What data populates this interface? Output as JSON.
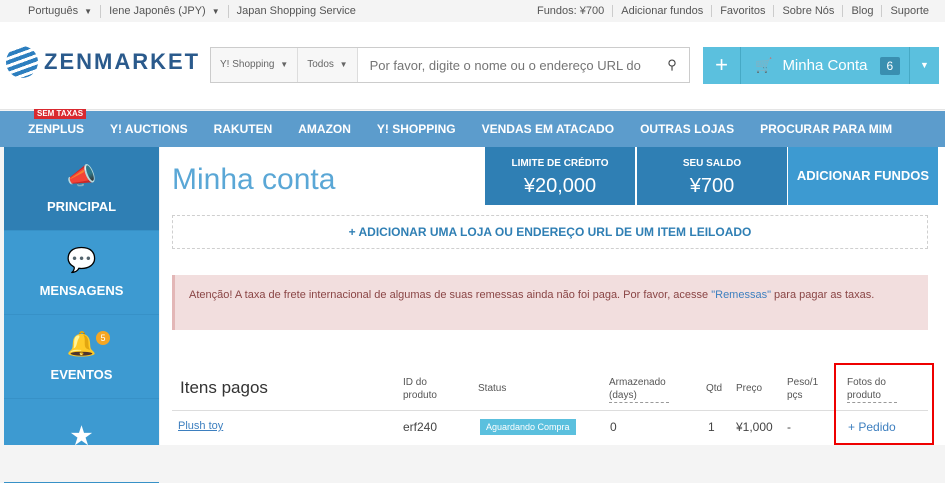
{
  "topbar": {
    "language": "Português",
    "currency": "Iene Japonês (JPY)",
    "service": "Japan Shopping Service",
    "links": [
      "Fundos: ¥700",
      "Adicionar fundos",
      "Favoritos",
      "Sobre Nós",
      "Blog",
      "Suporte"
    ]
  },
  "header": {
    "logo": "ZENMARKET",
    "search_source": "Y! Shopping",
    "search_category": "Todos",
    "search_placeholder": "Por favor, digite o nome ou o endereço URL do",
    "account_label": "Minha Conta",
    "account_badge": "6"
  },
  "nav": {
    "tag": "SEM TAXAS",
    "items": [
      "ZENPLUS",
      "Y! AUCTIONS",
      "RAKUTEN",
      "AMAZON",
      "Y! SHOPPING",
      "VENDAS EM ATACADO",
      "OUTRAS LOJAS",
      "PROCURAR PARA MIM"
    ]
  },
  "sidebar": {
    "items": [
      {
        "label": "PRINCIPAL",
        "icon": "megaphone-icon"
      },
      {
        "label": "MENSAGENS",
        "icon": "chat-icon"
      },
      {
        "label": "EVENTOS",
        "icon": "bell-icon",
        "badge": "5"
      },
      {
        "label": "",
        "icon": "star-icon"
      }
    ]
  },
  "main": {
    "title": "Minha conta",
    "credit_label": "LIMITE DE CRÉDITO",
    "credit_value": "¥20,000",
    "balance_label": "SEU SALDO",
    "balance_value": "¥700",
    "add_funds": "ADICIONAR FUNDOS",
    "add_item": "+ ADICIONAR UMA LOJA OU ENDEREÇO URL DE UM ITEM LEILOADO",
    "alert_pre": "Atenção! A taxa de frete internacional de algumas de suas remessas ainda não foi paga. Por favor, acesse ",
    "alert_link": "\"Remessas\"",
    "alert_post": " para pagar as taxas."
  },
  "table": {
    "section_title": "Itens pagos",
    "headers": {
      "id": "ID do produto",
      "status": "Status",
      "stored": "Armazenado (days)",
      "qty": "Qtd",
      "price": "Preço",
      "weight": "Peso/1 pçs",
      "photos": "Fotos do produto"
    },
    "rows": [
      {
        "name": "Plush toy",
        "id": "erf240",
        "status": "Aguardando Compra",
        "stored": "0",
        "qty": "1",
        "price": "¥1,000",
        "weight": "-",
        "photos": "+ Pedido"
      }
    ]
  },
  "colors": {
    "accent": "#3d9ad1",
    "dark": "#2f7fb4",
    "light": "#5bc0de",
    "alert_bg": "#f2dede"
  }
}
